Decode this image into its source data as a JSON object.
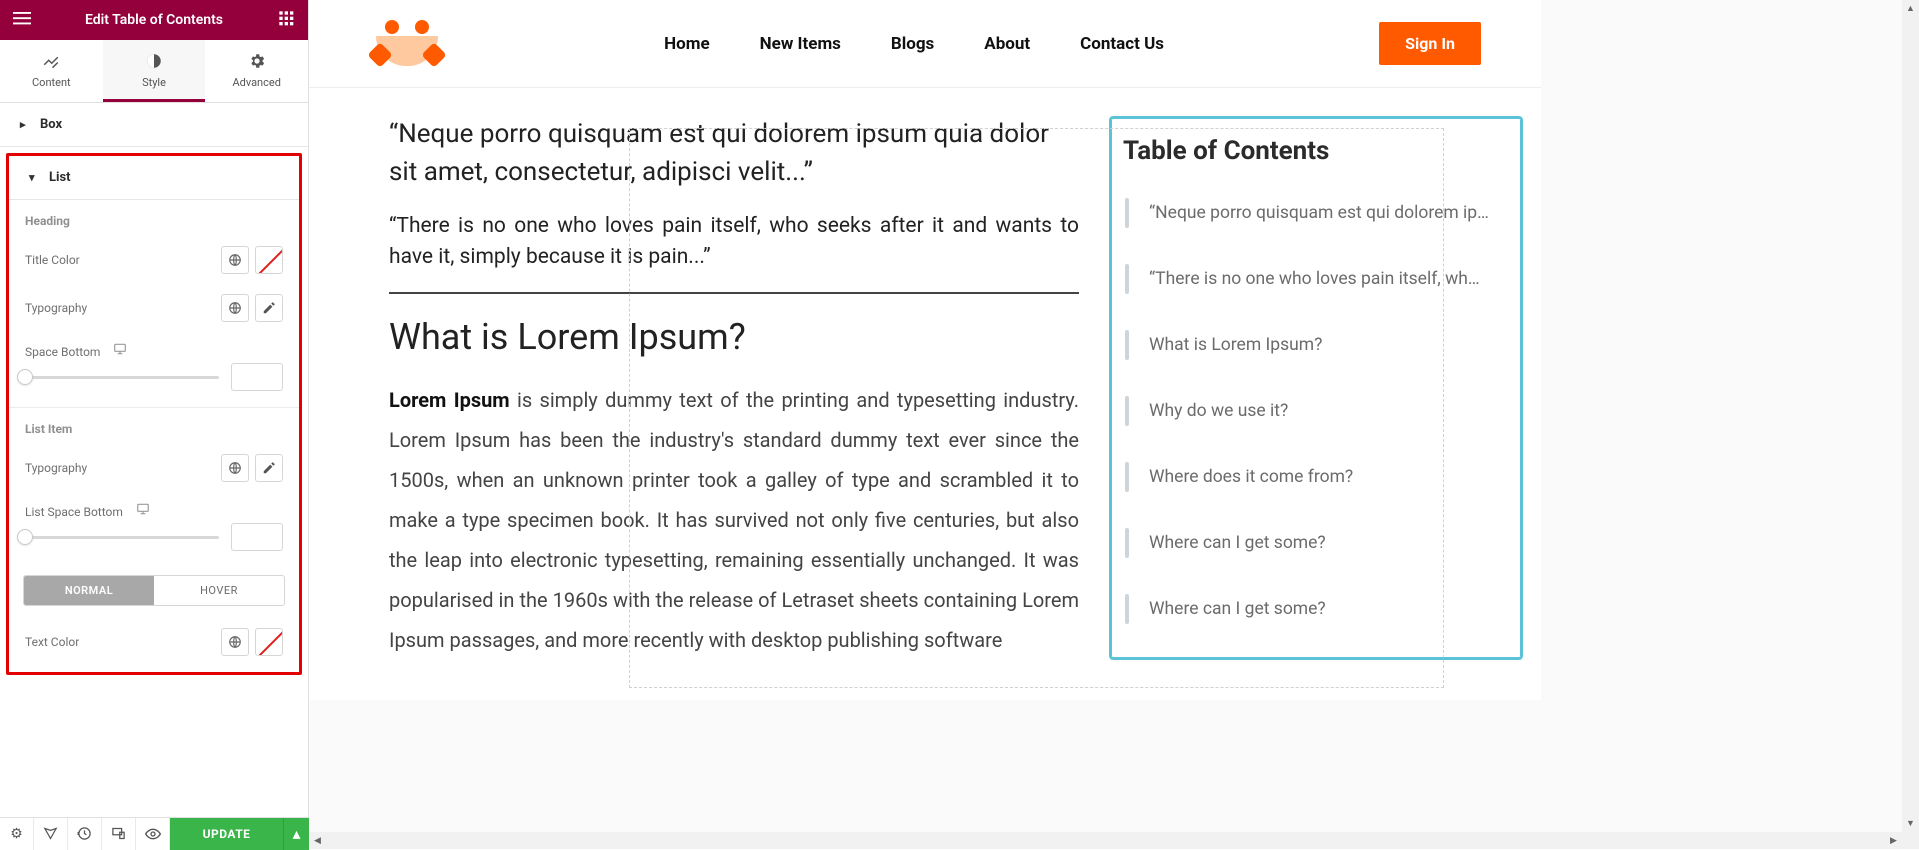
{
  "editor": {
    "title": "Edit Table of Contents",
    "tabs": {
      "content": "Content",
      "style": "Style",
      "advanced": "Advanced",
      "active": "style"
    },
    "accordion_box": "Box",
    "accordion_list": "List",
    "heading_group": "Heading",
    "controls": {
      "title_color": "Title Color",
      "typography": "Typography",
      "space_bottom": "Space Bottom",
      "list_item_group": "List Item",
      "list_typography": "Typography",
      "list_space_bottom": "List Space Bottom",
      "text_color": "Text Color"
    },
    "state_tabs": {
      "normal": "NORMAL",
      "hover": "HOVER",
      "active": "normal"
    },
    "update": "UPDATE"
  },
  "site": {
    "nav": {
      "home": "Home",
      "new_items": "New Items",
      "blogs": "Blogs",
      "about": "About",
      "contact": "Contact Us",
      "signin": "Sign In"
    },
    "quotes": {
      "q1": "“Neque porro quisquam est qui dolorem ipsum quia dolor sit amet, consectetur, adipisci velit...”",
      "q2": "“There is no one who loves pain itself, who seeks after it and wants to have it, simply because it is pain...”"
    },
    "heading": "What is Lorem Ipsum?",
    "body_lead": "Lorem Ipsum",
    "body": " is simply dummy text of the printing and typesetting industry. Lorem Ipsum has been the industry's standard dummy text ever since the 1500s, when an unknown printer took a galley of type and scrambled it to make a type specimen book. It has survived not only five centuries, but also the leap into electronic typesetting, remaining essentially unchanged. It was popularised in the 1960s with the release of Letraset sheets containing Lorem Ipsum passages, and more recently with desktop publishing software"
  },
  "toc": {
    "title": "Table of Contents",
    "items": [
      "“Neque porro quisquam est qui dolorem ips...",
      "“There is no one who loves pain itself, who s...",
      "What is Lorem Ipsum?",
      "Why do we use it?",
      "Where does it come from?",
      "Where can I get some?",
      "Where can I get some?"
    ]
  }
}
